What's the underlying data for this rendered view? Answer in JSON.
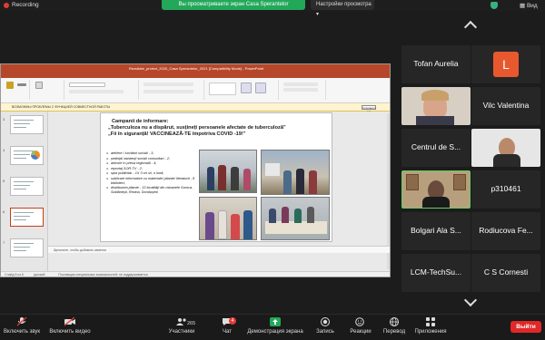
{
  "topbar": {
    "recording_label": "Recording",
    "share_banner": "Вы просматриваете экран Casa Sperantelor",
    "view_options": "Настройки просмотра",
    "view_label": "Вид"
  },
  "ppt": {
    "window_title": "Rezultate_proiect_2020_Casa Sperantelor_2021 [Compatibility Mode] - PowerPoint",
    "tabs": [
      "Файл",
      "Главная",
      "Вставка",
      "Дизайн",
      "Переходы",
      "Анимация",
      "Слайд-шоу",
      "Рецензирование",
      "Вид",
      "Справка",
      "Что вы хотите сделать?"
    ],
    "warning_title": "ВОЗМОЖНЫ ПРОБЛЕМЫ С ФУНКЦИЕЙ СОВМЕСТНОЙ РАБОТЫ",
    "warning_button": "Сохранить как",
    "thumb_numbers": [
      "3",
      "4",
      "5",
      "6",
      "7"
    ],
    "notes_placeholder": "Щелкните, чтобы добавить заметки",
    "status_left": "Слайд 5 из 6",
    "status_lang": "русский",
    "status_mid": "Поставщик специальных возможностей: не поддерживается",
    "slide": {
      "heading": "Campanii de informare:",
      "line1": "„Tuberculoza nu a dispărut, susțineți persoanele afectate de tuberculoză”",
      "line2": "„Fii în siguranță! VACCINEAZĂ-TE împotriva COVID -19!”",
      "bullets": [
        "ateliere / lucrători sociali - 3;",
        "ședință/ asistenți sociali comunitari - 2;",
        "articole în presa regională - 4;",
        "reportaj SOR-TV - 2;",
        "spot publicitar - 1X 3 ori /zi, o lună;",
        "sublicare informative cu materiale/ pliante/ literatură - 8 biblioteci;",
        "distribuirea pliante - 13 localități din raioanele Soroca, Soldănești, Rezina, Dondușeni"
      ]
    }
  },
  "participants": [
    {
      "name": "Tofan Aurelia",
      "type": "name"
    },
    {
      "name": "L",
      "type": "avatar",
      "color": "#e8582e"
    },
    {
      "name": "",
      "type": "video"
    },
    {
      "name": "Vilc Valentina",
      "type": "name"
    },
    {
      "name": "Centrul de  S...",
      "type": "name"
    },
    {
      "name": "",
      "type": "video"
    },
    {
      "name": "",
      "type": "video"
    },
    {
      "name": "p310461",
      "type": "name"
    },
    {
      "name": "Bolgari Ala S...",
      "type": "name"
    },
    {
      "name": "Rodiucova Fe...",
      "type": "name"
    },
    {
      "name": "LCM-TechSu...",
      "type": "name"
    },
    {
      "name": "C S Cornesti",
      "type": "name"
    }
  ],
  "toolbar": {
    "mic_label": "Включить звук",
    "video_label": "Включить видео",
    "participants_label": "Участники",
    "participants_count": "265",
    "chat_label": "Чат",
    "chat_badge": "4",
    "share_label": "Демонстрация экрана",
    "record_label": "Запись",
    "reactions_label": "Реакции",
    "translate_label": "Перевод",
    "apps_label": "Приложения",
    "leave_label": "Выйти"
  },
  "colors": {
    "ppt_accent": "#b7472a",
    "share_green": "#23a85a",
    "leave_red": "#e02828",
    "avatar_L": "#e8582e"
  }
}
